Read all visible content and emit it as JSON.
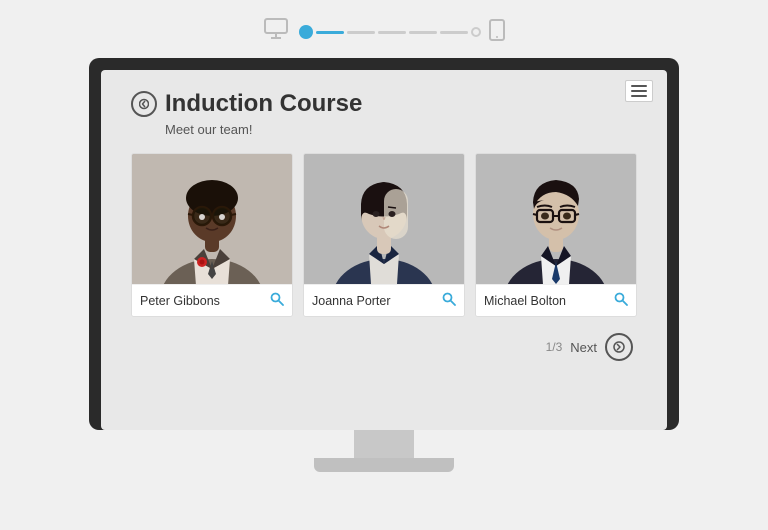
{
  "topbar": {
    "monitor_icon": "🖥",
    "mobile_icon": "📱"
  },
  "progress": {
    "segments": [
      {
        "filled": true
      },
      {
        "filled": false
      },
      {
        "filled": false
      },
      {
        "filled": false
      },
      {
        "filled": false
      },
      {
        "filled": false
      }
    ]
  },
  "screen": {
    "menu_icon_label": "menu",
    "back_icon": "←",
    "title": "Induction Course",
    "subtitle": "Meet our team!",
    "team_cards": [
      {
        "name": "Peter Gibbons",
        "avatar_type": "peter"
      },
      {
        "name": "Joanna Porter",
        "avatar_type": "joanna"
      },
      {
        "name": "Michael Bolton",
        "avatar_type": "michael"
      }
    ],
    "nav": {
      "counter": "1/3",
      "next_label": "Next",
      "next_icon": "→"
    }
  }
}
